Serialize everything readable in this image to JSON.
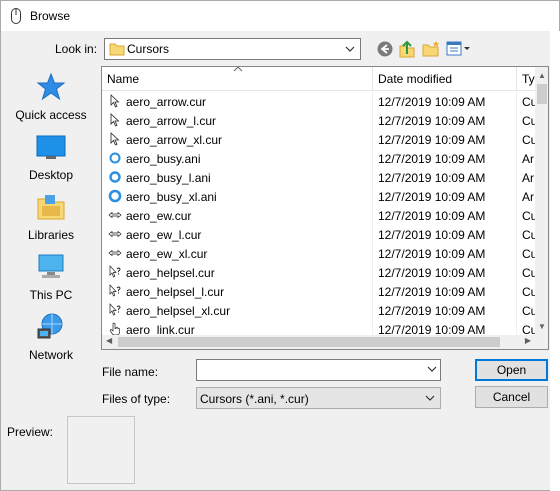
{
  "window": {
    "title": "Browse"
  },
  "lookin": {
    "label": "Look in:",
    "value": "Cursors"
  },
  "places": [
    {
      "label": "Quick access",
      "icon": "star-icon"
    },
    {
      "label": "Desktop",
      "icon": "desktop-icon"
    },
    {
      "label": "Libraries",
      "icon": "libraries-icon"
    },
    {
      "label": "This PC",
      "icon": "computer-icon"
    },
    {
      "label": "Network",
      "icon": "network-icon"
    }
  ],
  "list": {
    "columns": {
      "name": "Name",
      "date": "Date modified",
      "type": "Ty"
    },
    "rows": [
      {
        "name": "aero_arrow.cur",
        "date": "12/7/2019 10:09 AM",
        "type": "Cu",
        "icon": "arrow-cursor-icon"
      },
      {
        "name": "aero_arrow_l.cur",
        "date": "12/7/2019 10:09 AM",
        "type": "Cu",
        "icon": "arrow-cursor-icon"
      },
      {
        "name": "aero_arrow_xl.cur",
        "date": "12/7/2019 10:09 AM",
        "type": "Cu",
        "icon": "arrow-cursor-icon"
      },
      {
        "name": "aero_busy.ani",
        "date": "12/7/2019 10:09 AM",
        "type": "Ar",
        "icon": "busy-cursor-icon"
      },
      {
        "name": "aero_busy_l.ani",
        "date": "12/7/2019 10:09 AM",
        "type": "Ar",
        "icon": "busy-cursor-icon"
      },
      {
        "name": "aero_busy_xl.ani",
        "date": "12/7/2019 10:09 AM",
        "type": "Ar",
        "icon": "busy-cursor-icon"
      },
      {
        "name": "aero_ew.cur",
        "date": "12/7/2019 10:09 AM",
        "type": "Cu",
        "icon": "resize-ew-cursor-icon"
      },
      {
        "name": "aero_ew_l.cur",
        "date": "12/7/2019 10:09 AM",
        "type": "Cu",
        "icon": "resize-ew-cursor-icon"
      },
      {
        "name": "aero_ew_xl.cur",
        "date": "12/7/2019 10:09 AM",
        "type": "Cu",
        "icon": "resize-ew-cursor-icon"
      },
      {
        "name": "aero_helpsel.cur",
        "date": "12/7/2019 10:09 AM",
        "type": "Cu",
        "icon": "help-cursor-icon"
      },
      {
        "name": "aero_helpsel_l.cur",
        "date": "12/7/2019 10:09 AM",
        "type": "Cu",
        "icon": "help-cursor-icon"
      },
      {
        "name": "aero_helpsel_xl.cur",
        "date": "12/7/2019 10:09 AM",
        "type": "Cu",
        "icon": "help-cursor-icon"
      },
      {
        "name": "aero_link.cur",
        "date": "12/7/2019 10:09 AM",
        "type": "Cu",
        "icon": "hand-cursor-icon"
      }
    ]
  },
  "filename": {
    "label": "File name:",
    "value": ""
  },
  "filetype": {
    "label": "Files of type:",
    "value": "Cursors (*.ani, *.cur)"
  },
  "buttons": {
    "open": "Open",
    "cancel": "Cancel"
  },
  "preview": {
    "label": "Preview:"
  },
  "colors": {
    "accent": "#0078d7",
    "folder": "#f8d775"
  }
}
